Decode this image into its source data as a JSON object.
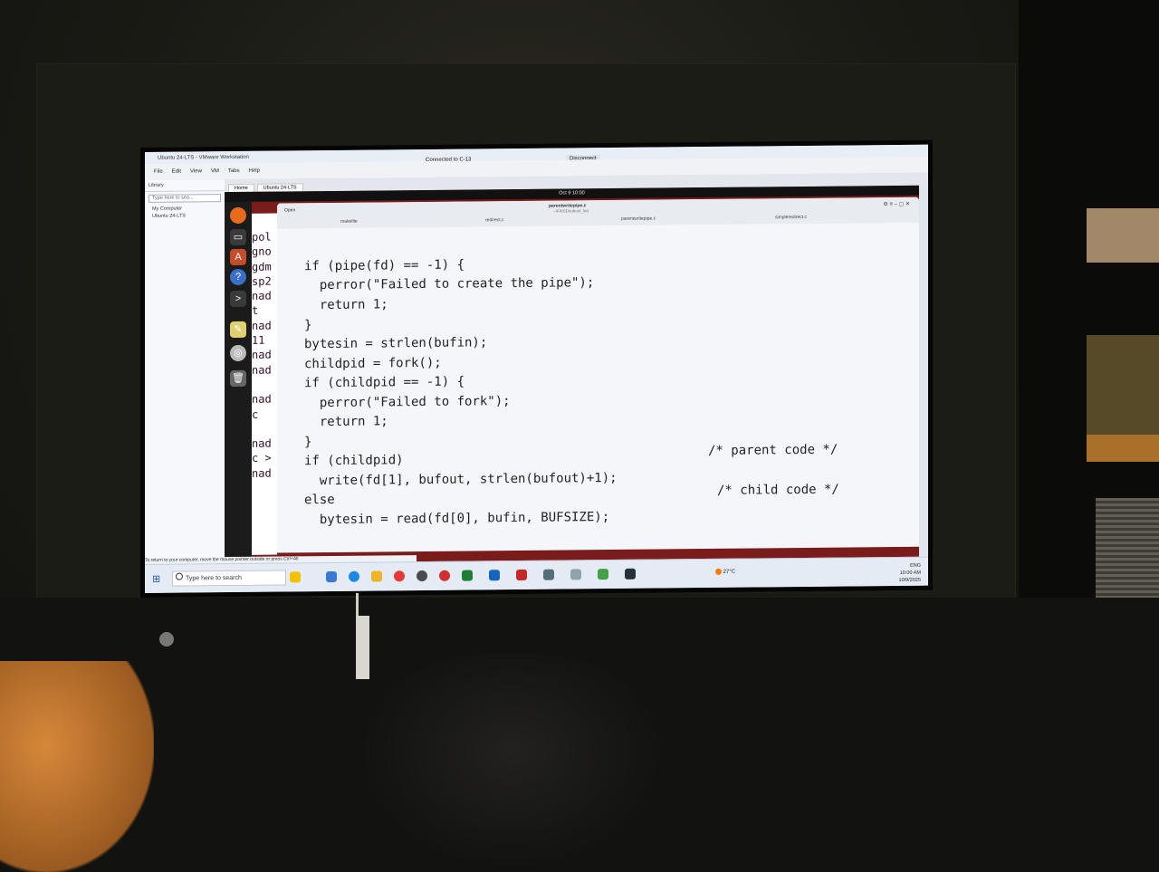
{
  "vmware": {
    "window_title": "Ubuntu 24-LTS - VMware Workstation",
    "menu": [
      "File",
      "Edit",
      "View",
      "VM",
      "Tabs",
      "Help"
    ],
    "connection_status": "Connected to C-13",
    "disconnect_label": "Disconnect",
    "library_label": "Library",
    "library_search_placeholder": "Type here to sea...",
    "library_items": [
      "My Computer",
      "Ubuntu 24-LTS"
    ],
    "tabs": [
      "Home",
      "Ubuntu 24-LTS"
    ],
    "status_hint": "To return to your computer, move the mouse pointer outside or press Ctrl+Alt"
  },
  "ubuntu": {
    "clock": "Oct 9  10:00",
    "terminal_lines": [
      "pol",
      "gno",
      "gdm",
      "sp2",
      "nad",
      "t",
      "nad",
      "11",
      "nad",
      "nad",
      "",
      "nad",
      "c",
      "",
      "nad",
      "c >",
      "nad"
    ]
  },
  "editor": {
    "open_label": "Open",
    "title": "parentwritepipe.c",
    "path": "~/FAISD/edtool_lnd",
    "tabs": [
      "makefile",
      "redirect.c",
      "parentwritepipe.c",
      "simpleredirect.c"
    ],
    "code_lines": [
      "if (pipe(fd) == -1) {",
      "  perror(\"Failed to create the pipe\");",
      "  return 1;",
      "}",
      "bytesin = strlen(bufin);",
      "childpid = fork();",
      "if (childpid == -1) {",
      "  perror(\"Failed to fork\");",
      "  return 1;",
      "}",
      "if (childpid)",
      "  write(fd[1], bufout, strlen(bufout)+1);",
      "else",
      "  bytesin = read(fd[0], bufin, BUFSIZE);"
    ],
    "comments": [
      "/* parent code */",
      "/* child code */"
    ]
  },
  "windows_taskbar": {
    "search_placeholder": "Type here to search",
    "temperature": "27°C",
    "language": "ENG",
    "time": "10:00 AM",
    "date": "10/9/2025"
  }
}
